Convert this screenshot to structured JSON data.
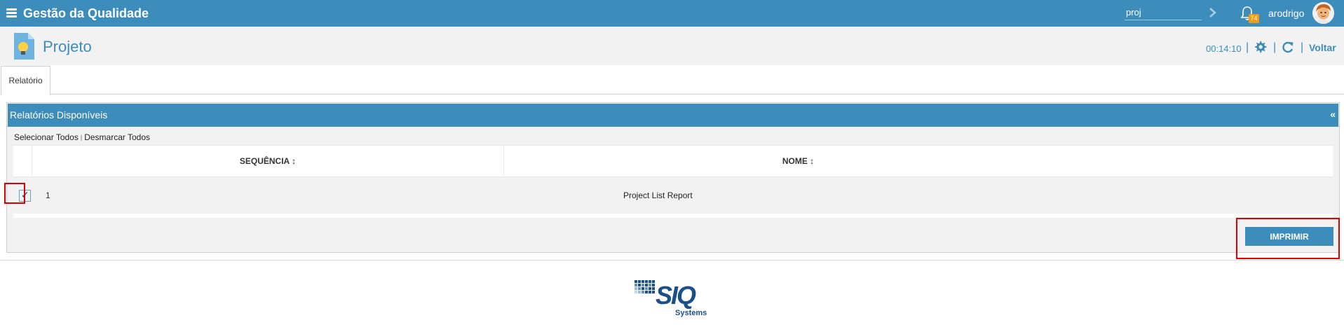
{
  "topbar": {
    "title": "Gestão da Qualidade",
    "search_value": "proj",
    "notifications_count": "74",
    "username": "arodrigo"
  },
  "header": {
    "title": "Projeto",
    "timer": "00:14:10",
    "back_label": "Voltar"
  },
  "tabs": [
    {
      "label": "Relatório"
    }
  ],
  "panel": {
    "title": "Relatórios Disponíveis",
    "collapse_icon": "«",
    "select_all": "Selecionar Todos",
    "deselect_all": "Desmarcar Todos",
    "columns": [
      {
        "label": "SEQUÊNCIA ↕"
      },
      {
        "label": "NOME ↕"
      }
    ],
    "rows": [
      {
        "checked": true,
        "sequence": "1",
        "name": "Project List Report"
      }
    ],
    "print_label": "IMPRIMIR"
  },
  "footer": {
    "logo_text": "SIQ",
    "logo_sub": "Systems"
  },
  "colors": {
    "primary": "#3c8dbc",
    "header_bg": "#f2f2f2",
    "badge": "#f39c12",
    "highlight": "#e00000",
    "logo": "#1c4f8a"
  },
  "icons": [
    "menu-icon",
    "chevron-right-icon",
    "bell-icon",
    "avatar-icon",
    "project-document-icon",
    "gear-icon",
    "refresh-icon",
    "siq-logo"
  ]
}
